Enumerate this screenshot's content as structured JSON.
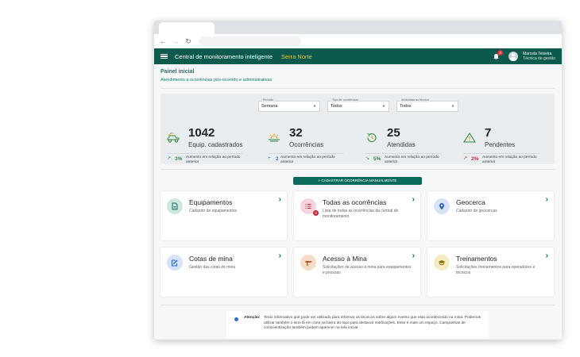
{
  "browser": {
    "back_icon": "arrow-left-icon",
    "forward_icon": "arrow-right-icon",
    "reload_icon": "reload-icon"
  },
  "appbar": {
    "title": "Central de monitoramento inteligente",
    "region": "Serra Norte",
    "notification_count": "3",
    "user_name": "Marcela Teixeira",
    "user_role": "Técnica de gestão"
  },
  "page": {
    "title": "Painel inicial",
    "subtitle": "Atendimento a ocorrências pós-ocorrido e administrativas"
  },
  "filters": [
    {
      "label": "Período",
      "value": "Semana"
    },
    {
      "label": "Tipo de ocorrências",
      "value": "Todos"
    },
    {
      "label": "Atribuidas ao técnico",
      "value": "Todos"
    }
  ],
  "stats": [
    {
      "value": "1042",
      "label": "Equip. cadastrados",
      "trend": "3%",
      "trend_text": "Aumento em relação ao período anterior",
      "icon": "equipment-icon",
      "trend_icon": "trend-up-icon",
      "color": "#2e8b3e"
    },
    {
      "value": "32",
      "label": "Ocorrências",
      "trend": "2",
      "trend_text": "Aumento em relação ao período anterior",
      "icon": "occurrence-icon",
      "trend_icon": "plus-icon",
      "color": "#2b6fd6"
    },
    {
      "value": "25",
      "label": "Atendidas",
      "trend": "5%",
      "trend_text": "Aumento em relação ao período anterior",
      "icon": "attended-icon",
      "trend_icon": "trend-down-icon",
      "color": "#2e8b3e"
    },
    {
      "value": "7",
      "label": "Pendentes",
      "trend": "2%",
      "trend_text": "Aumento em relação ao período anterior",
      "icon": "warning-icon",
      "trend_icon": "trend-up-icon",
      "color": "#c8283c"
    }
  ],
  "cta": {
    "label": "+ CADASTRAR OCORRÊNCIA MANUALMENTE"
  },
  "cards": [
    {
      "title": "Equipamentos",
      "desc": "Cadastro de equipamentos",
      "icon": "equipment-doc-icon",
      "bg": "#cfe8e3",
      "fg": "#0b6b5c"
    },
    {
      "title": "Todas as ocorrências",
      "desc": "Lista de todas as ocorrências da central de monitoramento",
      "icon": "list-icon",
      "bg": "#f6d6dc",
      "fg": "#c8283c",
      "badge": "3"
    },
    {
      "title": "Geocerca",
      "desc": "Cadastro de geocercas",
      "icon": "location-pin-icon",
      "bg": "#d6e2f7",
      "fg": "#2b5fc4"
    },
    {
      "title": "Cotas de mina",
      "desc": "Gestão das cotas de mina",
      "icon": "edit-doc-icon",
      "bg": "#d6e2f7",
      "fg": "#2b5fc4"
    },
    {
      "title": "Acesso à Mina",
      "desc": "Solicitações de acesso à mina para equipamentos e pessoas",
      "icon": "hammer-icon",
      "bg": "#f6dcc8",
      "fg": "#b5541c"
    },
    {
      "title": "Treinamentos",
      "desc": "Solicitações treinamentos para operadores e técnicos",
      "icon": "graduation-cap-icon",
      "bg": "#f6ebc2",
      "fg": "#8c6d0b"
    }
  ],
  "notice": {
    "label": "Atenção:",
    "text": "Texto informativo que pode ser utilizado para informar os técnicos sobre algum evento que esta acontecendo na mina. Podemos utilizar também o sino lá em cima na barra do topo para destacar notificações. Esse é mais um espaço. Campanhas de conscientização também podem aparecer na tela inicial."
  }
}
